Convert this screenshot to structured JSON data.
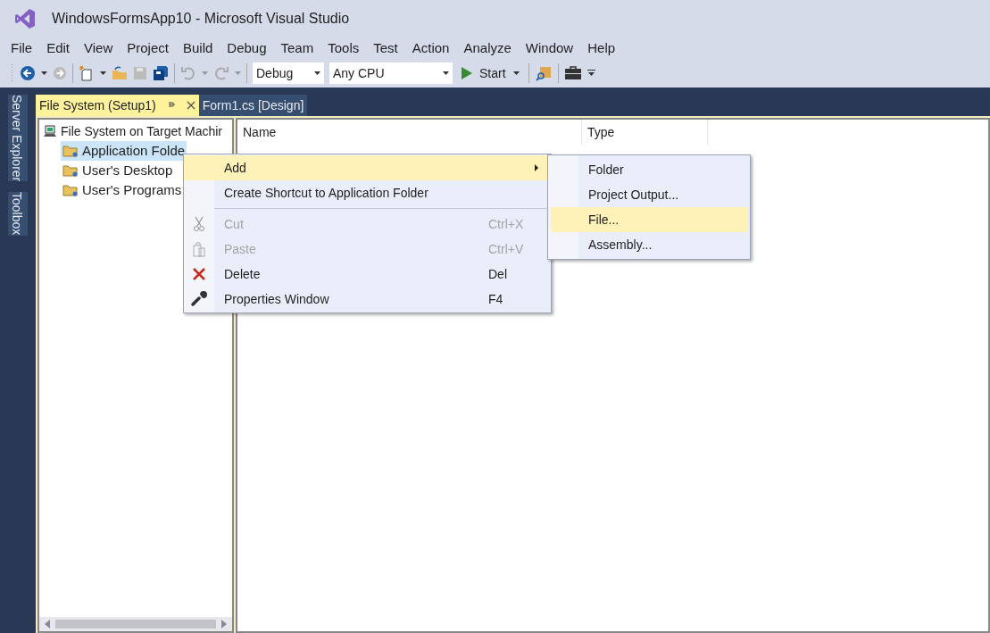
{
  "window": {
    "title": "WindowsFormsApp10 - Microsoft Visual Studio"
  },
  "menu_bar": [
    "File",
    "Edit",
    "View",
    "Project",
    "Build",
    "Debug",
    "Team",
    "Tools",
    "Test",
    "Action",
    "Analyze",
    "Window",
    "Help"
  ],
  "toolbar": {
    "configuration": "Debug",
    "platform": "Any CPU",
    "start": "Start"
  },
  "side_tabs": [
    "Server Explorer",
    "Toolbox"
  ],
  "document_tabs": [
    {
      "label": "File System (Setup1)",
      "selected": true
    },
    {
      "label": "Form1.cs [Design]",
      "selected": false
    }
  ],
  "tree": {
    "label": "File System on Target Machir",
    "children": [
      {
        "label": "Application Folde",
        "selected": true
      },
      {
        "label": "User's Desktop",
        "selected": false
      },
      {
        "label": "User's Programs",
        "selected": false
      }
    ]
  },
  "list_columns": [
    "Name",
    "Type"
  ],
  "context_menu": [
    {
      "kind": "item",
      "label": "Add",
      "submenu": true,
      "selected": true,
      "disabled": false
    },
    {
      "kind": "item",
      "label": "Create Shortcut to Application Folder",
      "submenu": false,
      "selected": false,
      "disabled": false
    },
    {
      "kind": "separator"
    },
    {
      "kind": "item",
      "label": "Cut",
      "shortcut": "Ctrl+X",
      "submenu": false,
      "selected": false,
      "disabled": true
    },
    {
      "kind": "item",
      "label": "Paste",
      "shortcut": "Ctrl+V",
      "submenu": false,
      "selected": false,
      "disabled": true
    },
    {
      "kind": "item",
      "label": "Delete",
      "shortcut": "Del",
      "submenu": false,
      "selected": false,
      "disabled": false
    },
    {
      "kind": "item",
      "label": "Properties Window",
      "shortcut": "F4",
      "submenu": false,
      "selected": false,
      "disabled": false
    }
  ],
  "submenu": [
    {
      "label": "Folder",
      "selected": false
    },
    {
      "label": "Project Output...",
      "selected": false
    },
    {
      "label": "File...",
      "selected": true
    },
    {
      "label": "Assembly...",
      "selected": false
    }
  ]
}
